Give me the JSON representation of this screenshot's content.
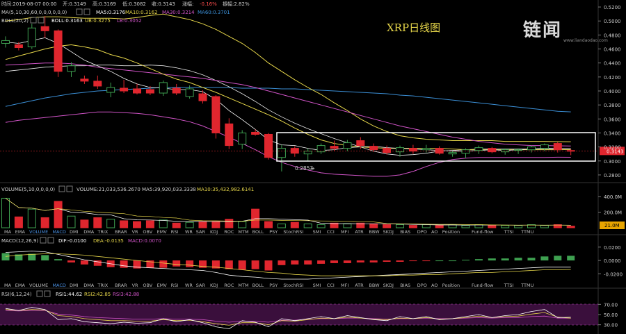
{
  "ohlc_bar": {
    "time_label": "时间:2019-08-07 00:00",
    "open_label": "开:0.3149",
    "high_label": "高:0.3169",
    "low_label": "低:0.3082",
    "close_label": "收:0.3143",
    "change_label": "涨幅:",
    "change_value": "-0.16%",
    "amplitude_label": "振幅:2.82%"
  },
  "ma_legend": {
    "name": "MA(5,10,30,60,0,0,0,0,0,0)",
    "ma5": "MA5:0.3176",
    "ma10": "MA10:0.3162",
    "ma30": "MA30:0.3214",
    "ma60": "MA60:0.3701"
  },
  "boll_legend": {
    "name": "BOLL(20,2)",
    "boll": "BOLL:0.3163",
    "ub": "UB:0.3275",
    "lb": "LB:0.3052"
  },
  "watermark": {
    "title": "XRP日线图",
    "logo_text": "链闻",
    "logo_sub": "www.liandaodao.com"
  },
  "price_axis": {
    "ticks": [
      "0.5200",
      "0.5000",
      "0.4800",
      "0.4600",
      "0.4400",
      "0.4200",
      "0.4000",
      "0.3800",
      "0.3600",
      "0.3400",
      "0.3200",
      "0.3000",
      "0.2800"
    ],
    "last_price": "0.3143",
    "low_marker": "0.2853"
  },
  "volume_legend": {
    "name": "VOLUME(5,10,0,0,0,0)",
    "volume": "VOLUME:21,033,536.2670",
    "ma5": "MA5:39,920,033.3338",
    "ma10": "MA10:35,432,982.6141"
  },
  "volume_axis": {
    "ticks": [
      "400.0M",
      "200.0M"
    ],
    "last_value": "21.0M"
  },
  "indicator_tabs": [
    "MA",
    "EMA",
    "VOLUME",
    "MACD",
    "DMI",
    "DMA",
    "TRIX",
    "BRAR",
    "VR",
    "OBV",
    "EMV",
    "RSI",
    "WR",
    "SAR",
    "KDJ",
    "ROC",
    "MTM",
    "BOLL",
    "PSY",
    "StochRSI",
    "SMI",
    "CCI",
    "MFI",
    "ATR",
    "BBW",
    "SKDJ",
    "BIAS",
    "DPO",
    "AO",
    "Position",
    "Fund-flow",
    "TTSI",
    "TTMU"
  ],
  "tabs_row1_active": [
    2,
    3
  ],
  "tabs_row2_active": [
    3
  ],
  "macd_legend": {
    "name": "MACD(12,26,9)",
    "dif": "DIF:-0.0100",
    "dea": "DEA:-0.0135",
    "macd": "MACD:0.0070"
  },
  "macd_axis": {
    "ticks": [
      "0.0200",
      "0.0000",
      "-0.0200"
    ]
  },
  "rsi_legend": {
    "name": "RSI(6,12,24)",
    "rsi1": "RSI1:44.62",
    "rsi2": "RSI2:42.85",
    "rsi3": "RSI3:42.88"
  },
  "rsi_axis": {
    "ticks": [
      "70.00",
      "50.00",
      "30.00"
    ]
  },
  "colors": {
    "up": "#3ea050",
    "down": "#e0262e",
    "ma5": "#ffffff",
    "ma10": "#e6d64a",
    "ma30": "#d154c8",
    "ma60": "#3b8fd6",
    "boll": "#ffffff",
    "ub": "#e6d64a",
    "lb": "#d154c8",
    "change": "#ff4d4d"
  },
  "chart_data": {
    "type": "candlestick",
    "ylim": [
      0.27,
      0.53
    ],
    "candles": [
      {
        "o": 0.468,
        "h": 0.478,
        "l": 0.462,
        "c": 0.472
      },
      {
        "o": 0.466,
        "h": 0.47,
        "l": 0.458,
        "c": 0.462
      },
      {
        "o": 0.463,
        "h": 0.496,
        "l": 0.46,
        "c": 0.49
      },
      {
        "o": 0.492,
        "h": 0.507,
        "l": 0.476,
        "c": 0.486
      },
      {
        "o": 0.486,
        "h": 0.488,
        "l": 0.42,
        "c": 0.428
      },
      {
        "o": 0.428,
        "h": 0.441,
        "l": 0.42,
        "c": 0.436
      },
      {
        "o": 0.417,
        "h": 0.422,
        "l": 0.41,
        "c": 0.414
      },
      {
        "o": 0.414,
        "h": 0.422,
        "l": 0.403,
        "c": 0.407
      },
      {
        "o": 0.398,
        "h": 0.412,
        "l": 0.391,
        "c": 0.405
      },
      {
        "o": 0.404,
        "h": 0.416,
        "l": 0.397,
        "c": 0.4
      },
      {
        "o": 0.403,
        "h": 0.41,
        "l": 0.395,
        "c": 0.397
      },
      {
        "o": 0.402,
        "h": 0.407,
        "l": 0.394,
        "c": 0.397
      },
      {
        "o": 0.397,
        "h": 0.415,
        "l": 0.393,
        "c": 0.412
      },
      {
        "o": 0.404,
        "h": 0.41,
        "l": 0.394,
        "c": 0.397
      },
      {
        "o": 0.392,
        "h": 0.408,
        "l": 0.389,
        "c": 0.403
      },
      {
        "o": 0.396,
        "h": 0.401,
        "l": 0.382,
        "c": 0.386
      },
      {
        "o": 0.392,
        "h": 0.394,
        "l": 0.332,
        "c": 0.34
      },
      {
        "o": 0.353,
        "h": 0.361,
        "l": 0.317,
        "c": 0.322
      },
      {
        "o": 0.324,
        "h": 0.344,
        "l": 0.317,
        "c": 0.34
      },
      {
        "o": 0.341,
        "h": 0.345,
        "l": 0.336,
        "c": 0.338
      },
      {
        "o": 0.338,
        "h": 0.34,
        "l": 0.302,
        "c": 0.305
      },
      {
        "o": 0.305,
        "h": 0.323,
        "l": 0.285,
        "c": 0.318
      },
      {
        "o": 0.318,
        "h": 0.321,
        "l": 0.306,
        "c": 0.311
      },
      {
        "o": 0.31,
        "h": 0.318,
        "l": 0.3,
        "c": 0.314
      },
      {
        "o": 0.313,
        "h": 0.325,
        "l": 0.31,
        "c": 0.322
      },
      {
        "o": 0.321,
        "h": 0.329,
        "l": 0.314,
        "c": 0.318
      },
      {
        "o": 0.318,
        "h": 0.33,
        "l": 0.314,
        "c": 0.326
      },
      {
        "o": 0.329,
        "h": 0.334,
        "l": 0.317,
        "c": 0.322
      },
      {
        "o": 0.321,
        "h": 0.325,
        "l": 0.313,
        "c": 0.316
      },
      {
        "o": 0.318,
        "h": 0.322,
        "l": 0.309,
        "c": 0.312
      },
      {
        "o": 0.313,
        "h": 0.322,
        "l": 0.306,
        "c": 0.319
      },
      {
        "o": 0.318,
        "h": 0.323,
        "l": 0.31,
        "c": 0.314
      },
      {
        "o": 0.316,
        "h": 0.323,
        "l": 0.312,
        "c": 0.318
      },
      {
        "o": 0.318,
        "h": 0.321,
        "l": 0.309,
        "c": 0.311
      },
      {
        "o": 0.31,
        "h": 0.314,
        "l": 0.306,
        "c": 0.312
      },
      {
        "o": 0.311,
        "h": 0.318,
        "l": 0.304,
        "c": 0.316
      },
      {
        "o": 0.315,
        "h": 0.322,
        "l": 0.31,
        "c": 0.319
      },
      {
        "o": 0.318,
        "h": 0.32,
        "l": 0.311,
        "c": 0.313
      },
      {
        "o": 0.313,
        "h": 0.318,
        "l": 0.309,
        "c": 0.316
      },
      {
        "o": 0.315,
        "h": 0.318,
        "l": 0.31,
        "c": 0.316
      },
      {
        "o": 0.316,
        "h": 0.322,
        "l": 0.312,
        "c": 0.32
      },
      {
        "o": 0.318,
        "h": 0.325,
        "l": 0.314,
        "c": 0.323
      },
      {
        "o": 0.325,
        "h": 0.327,
        "l": 0.312,
        "c": 0.316
      },
      {
        "o": 0.3149,
        "h": 0.3169,
        "l": 0.3082,
        "c": 0.3143
      }
    ],
    "ma5": [
      0.47,
      0.468,
      0.472,
      0.476,
      0.468,
      0.456,
      0.444,
      0.436,
      0.428,
      0.418,
      0.41,
      0.405,
      0.404,
      0.402,
      0.402,
      0.399,
      0.388,
      0.372,
      0.359,
      0.345,
      0.33,
      0.323,
      0.322,
      0.318,
      0.315,
      0.316,
      0.319,
      0.32,
      0.321,
      0.319,
      0.318,
      0.317,
      0.316,
      0.315,
      0.314,
      0.314,
      0.315,
      0.316,
      0.315,
      0.316,
      0.317,
      0.318,
      0.318,
      0.3176
    ],
    "ma10": [
      0.445,
      0.45,
      0.455,
      0.46,
      0.464,
      0.466,
      0.463,
      0.459,
      0.452,
      0.447,
      0.44,
      0.432,
      0.424,
      0.417,
      0.412,
      0.405,
      0.398,
      0.39,
      0.382,
      0.374,
      0.366,
      0.357,
      0.347,
      0.338,
      0.33,
      0.325,
      0.322,
      0.32,
      0.319,
      0.318,
      0.318,
      0.318,
      0.318,
      0.318,
      0.317,
      0.316,
      0.316,
      0.316,
      0.316,
      0.316,
      0.316,
      0.316,
      0.316,
      0.3162
    ],
    "ma30": [
      0.437,
      0.438,
      0.439,
      0.44,
      0.44,
      0.439,
      0.437,
      0.434,
      0.432,
      0.43,
      0.428,
      0.426,
      0.424,
      0.422,
      0.42,
      0.418,
      0.415,
      0.412,
      0.409,
      0.405,
      0.4,
      0.395,
      0.39,
      0.385,
      0.38,
      0.375,
      0.37,
      0.365,
      0.36,
      0.355,
      0.35,
      0.346,
      0.342,
      0.338,
      0.334,
      0.331,
      0.328,
      0.326,
      0.324,
      0.323,
      0.322,
      0.322,
      0.3216,
      0.3214
    ],
    "ma60": [
      0.378,
      0.382,
      0.386,
      0.39,
      0.393,
      0.396,
      0.398,
      0.4,
      0.401,
      0.402,
      0.403,
      0.404,
      0.405,
      0.405,
      0.405,
      0.405,
      0.405,
      0.405,
      0.404,
      0.404,
      0.404,
      0.403,
      0.403,
      0.402,
      0.401,
      0.4,
      0.399,
      0.398,
      0.397,
      0.396,
      0.394,
      0.393,
      0.391,
      0.389,
      0.387,
      0.385,
      0.383,
      0.381,
      0.379,
      0.377,
      0.375,
      0.373,
      0.371,
      0.3701
    ],
    "ub": [
      0.5,
      0.502,
      0.505,
      0.506,
      0.506,
      0.505,
      0.504,
      0.504,
      0.504,
      0.503,
      0.505,
      0.508,
      0.51,
      0.506,
      0.502,
      0.496,
      0.488,
      0.478,
      0.468,
      0.455,
      0.44,
      0.428,
      0.416,
      0.405,
      0.395,
      0.383,
      0.372,
      0.36,
      0.35,
      0.342,
      0.336,
      0.333,
      0.331,
      0.33,
      0.329,
      0.329,
      0.329,
      0.329,
      0.328,
      0.328,
      0.328,
      0.328,
      0.3276,
      0.3275
    ],
    "lb": [
      0.355,
      0.358,
      0.36,
      0.362,
      0.364,
      0.366,
      0.368,
      0.37,
      0.37,
      0.369,
      0.368,
      0.366,
      0.363,
      0.36,
      0.356,
      0.35,
      0.342,
      0.334,
      0.325,
      0.316,
      0.306,
      0.298,
      0.292,
      0.287,
      0.283,
      0.281,
      0.28,
      0.279,
      0.278,
      0.278,
      0.28,
      0.285,
      0.292,
      0.298,
      0.302,
      0.304,
      0.305,
      0.305,
      0.305,
      0.305,
      0.305,
      0.305,
      0.3053,
      0.3052
    ],
    "boll": [
      0.428,
      0.43,
      0.432,
      0.434,
      0.435,
      0.436,
      0.436,
      0.437,
      0.437,
      0.436,
      0.436,
      0.437,
      0.436,
      0.433,
      0.429,
      0.423,
      0.415,
      0.406,
      0.396,
      0.385,
      0.373,
      0.363,
      0.354,
      0.346,
      0.339,
      0.332,
      0.326,
      0.32,
      0.314,
      0.31,
      0.308,
      0.309,
      0.311,
      0.314,
      0.315,
      0.316,
      0.317,
      0.317,
      0.317,
      0.317,
      0.317,
      0.317,
      0.3164,
      0.3163
    ],
    "volume": [
      0.38,
      0.14,
      0.24,
      0.13,
      0.34,
      0.15,
      0.1,
      0.13,
      0.11,
      0.09,
      0.08,
      0.09,
      0.1,
      0.06,
      0.07,
      0.08,
      0.08,
      0.11,
      0.08,
      0.24,
      0.08,
      0.05,
      0.07,
      0.05,
      0.04,
      0.06,
      0.05,
      0.06,
      0.05,
      0.04,
      0.04,
      0.03,
      0.04,
      0.03,
      0.04,
      0.03,
      0.04,
      0.03,
      0.03,
      0.03,
      0.04,
      0.03,
      0.04,
      0.021
    ],
    "volume_ylim": [
      0,
      0.42
    ],
    "macd_hist": [
      0.011,
      0.009,
      0.01,
      0.008,
      0.002,
      -0.003,
      -0.006,
      -0.008,
      -0.01,
      -0.011,
      -0.012,
      -0.011,
      -0.011,
      -0.009,
      -0.01,
      -0.011,
      -0.012,
      -0.013,
      -0.014,
      -0.013,
      -0.015,
      -0.007,
      -0.006,
      -0.006,
      -0.005,
      -0.004,
      -0.004,
      -0.003,
      -0.003,
      -0.002,
      -0.002,
      -0.001,
      -0.001,
      0.0,
      0.0,
      0.001,
      0.002,
      0.003,
      0.003,
      0.004,
      0.004,
      0.006,
      0.007,
      0.007
    ],
    "macd_dif": [
      0.012,
      0.013,
      0.014,
      0.013,
      0.009,
      0.005,
      0.001,
      -0.002,
      -0.005,
      -0.008,
      -0.01,
      -0.011,
      -0.012,
      -0.013,
      -0.014,
      -0.015,
      -0.018,
      -0.022,
      -0.024,
      -0.025,
      -0.027,
      -0.028,
      -0.028,
      -0.028,
      -0.027,
      -0.026,
      -0.025,
      -0.024,
      -0.023,
      -0.022,
      -0.021,
      -0.02,
      -0.019,
      -0.018,
      -0.017,
      -0.016,
      -0.015,
      -0.014,
      -0.013,
      -0.012,
      -0.011,
      -0.01,
      -0.01,
      -0.01
    ],
    "macd_dea": [
      0.006,
      0.008,
      0.009,
      0.01,
      0.01,
      0.009,
      0.008,
      0.006,
      0.004,
      0.002,
      0.0,
      -0.002,
      -0.004,
      -0.006,
      -0.007,
      -0.009,
      -0.01,
      -0.012,
      -0.014,
      -0.016,
      -0.018,
      -0.019,
      -0.021,
      -0.022,
      -0.023,
      -0.023,
      -0.023,
      -0.023,
      -0.023,
      -0.023,
      -0.022,
      -0.022,
      -0.021,
      -0.021,
      -0.02,
      -0.019,
      -0.018,
      -0.018,
      -0.017,
      -0.016,
      -0.015,
      -0.014,
      -0.014,
      -0.0135
    ],
    "macd_ylim": [
      -0.028,
      0.024
    ],
    "rsi1": [
      62,
      58,
      64,
      60,
      40,
      42,
      36,
      34,
      32,
      35,
      33,
      34,
      42,
      36,
      40,
      34,
      26,
      22,
      38,
      35,
      26,
      42,
      38,
      42,
      46,
      42,
      48,
      44,
      40,
      38,
      46,
      42,
      46,
      40,
      42,
      46,
      50,
      44,
      48,
      50,
      56,
      60,
      44,
      44.62
    ],
    "rsi2": [
      60,
      58,
      60,
      59,
      48,
      46,
      42,
      40,
      38,
      38,
      37,
      37,
      40,
      38,
      39,
      36,
      32,
      29,
      34,
      34,
      30,
      38,
      37,
      40,
      43,
      42,
      45,
      43,
      41,
      40,
      43,
      42,
      44,
      41,
      42,
      44,
      47,
      44,
      46,
      47,
      51,
      54,
      45,
      42.85
    ],
    "rsi3": [
      58,
      57,
      58,
      58,
      51,
      49,
      46,
      44,
      43,
      42,
      41,
      41,
      42,
      41,
      41,
      40,
      37,
      35,
      37,
      37,
      35,
      39,
      39,
      41,
      42,
      42,
      43,
      43,
      42,
      41,
      42,
      42,
      43,
      42,
      42,
      43,
      44,
      43,
      44,
      44,
      46,
      47,
      43,
      42.88
    ],
    "rsi_ylim": [
      20,
      80
    ],
    "highlight_range": [
      21,
      43
    ]
  }
}
